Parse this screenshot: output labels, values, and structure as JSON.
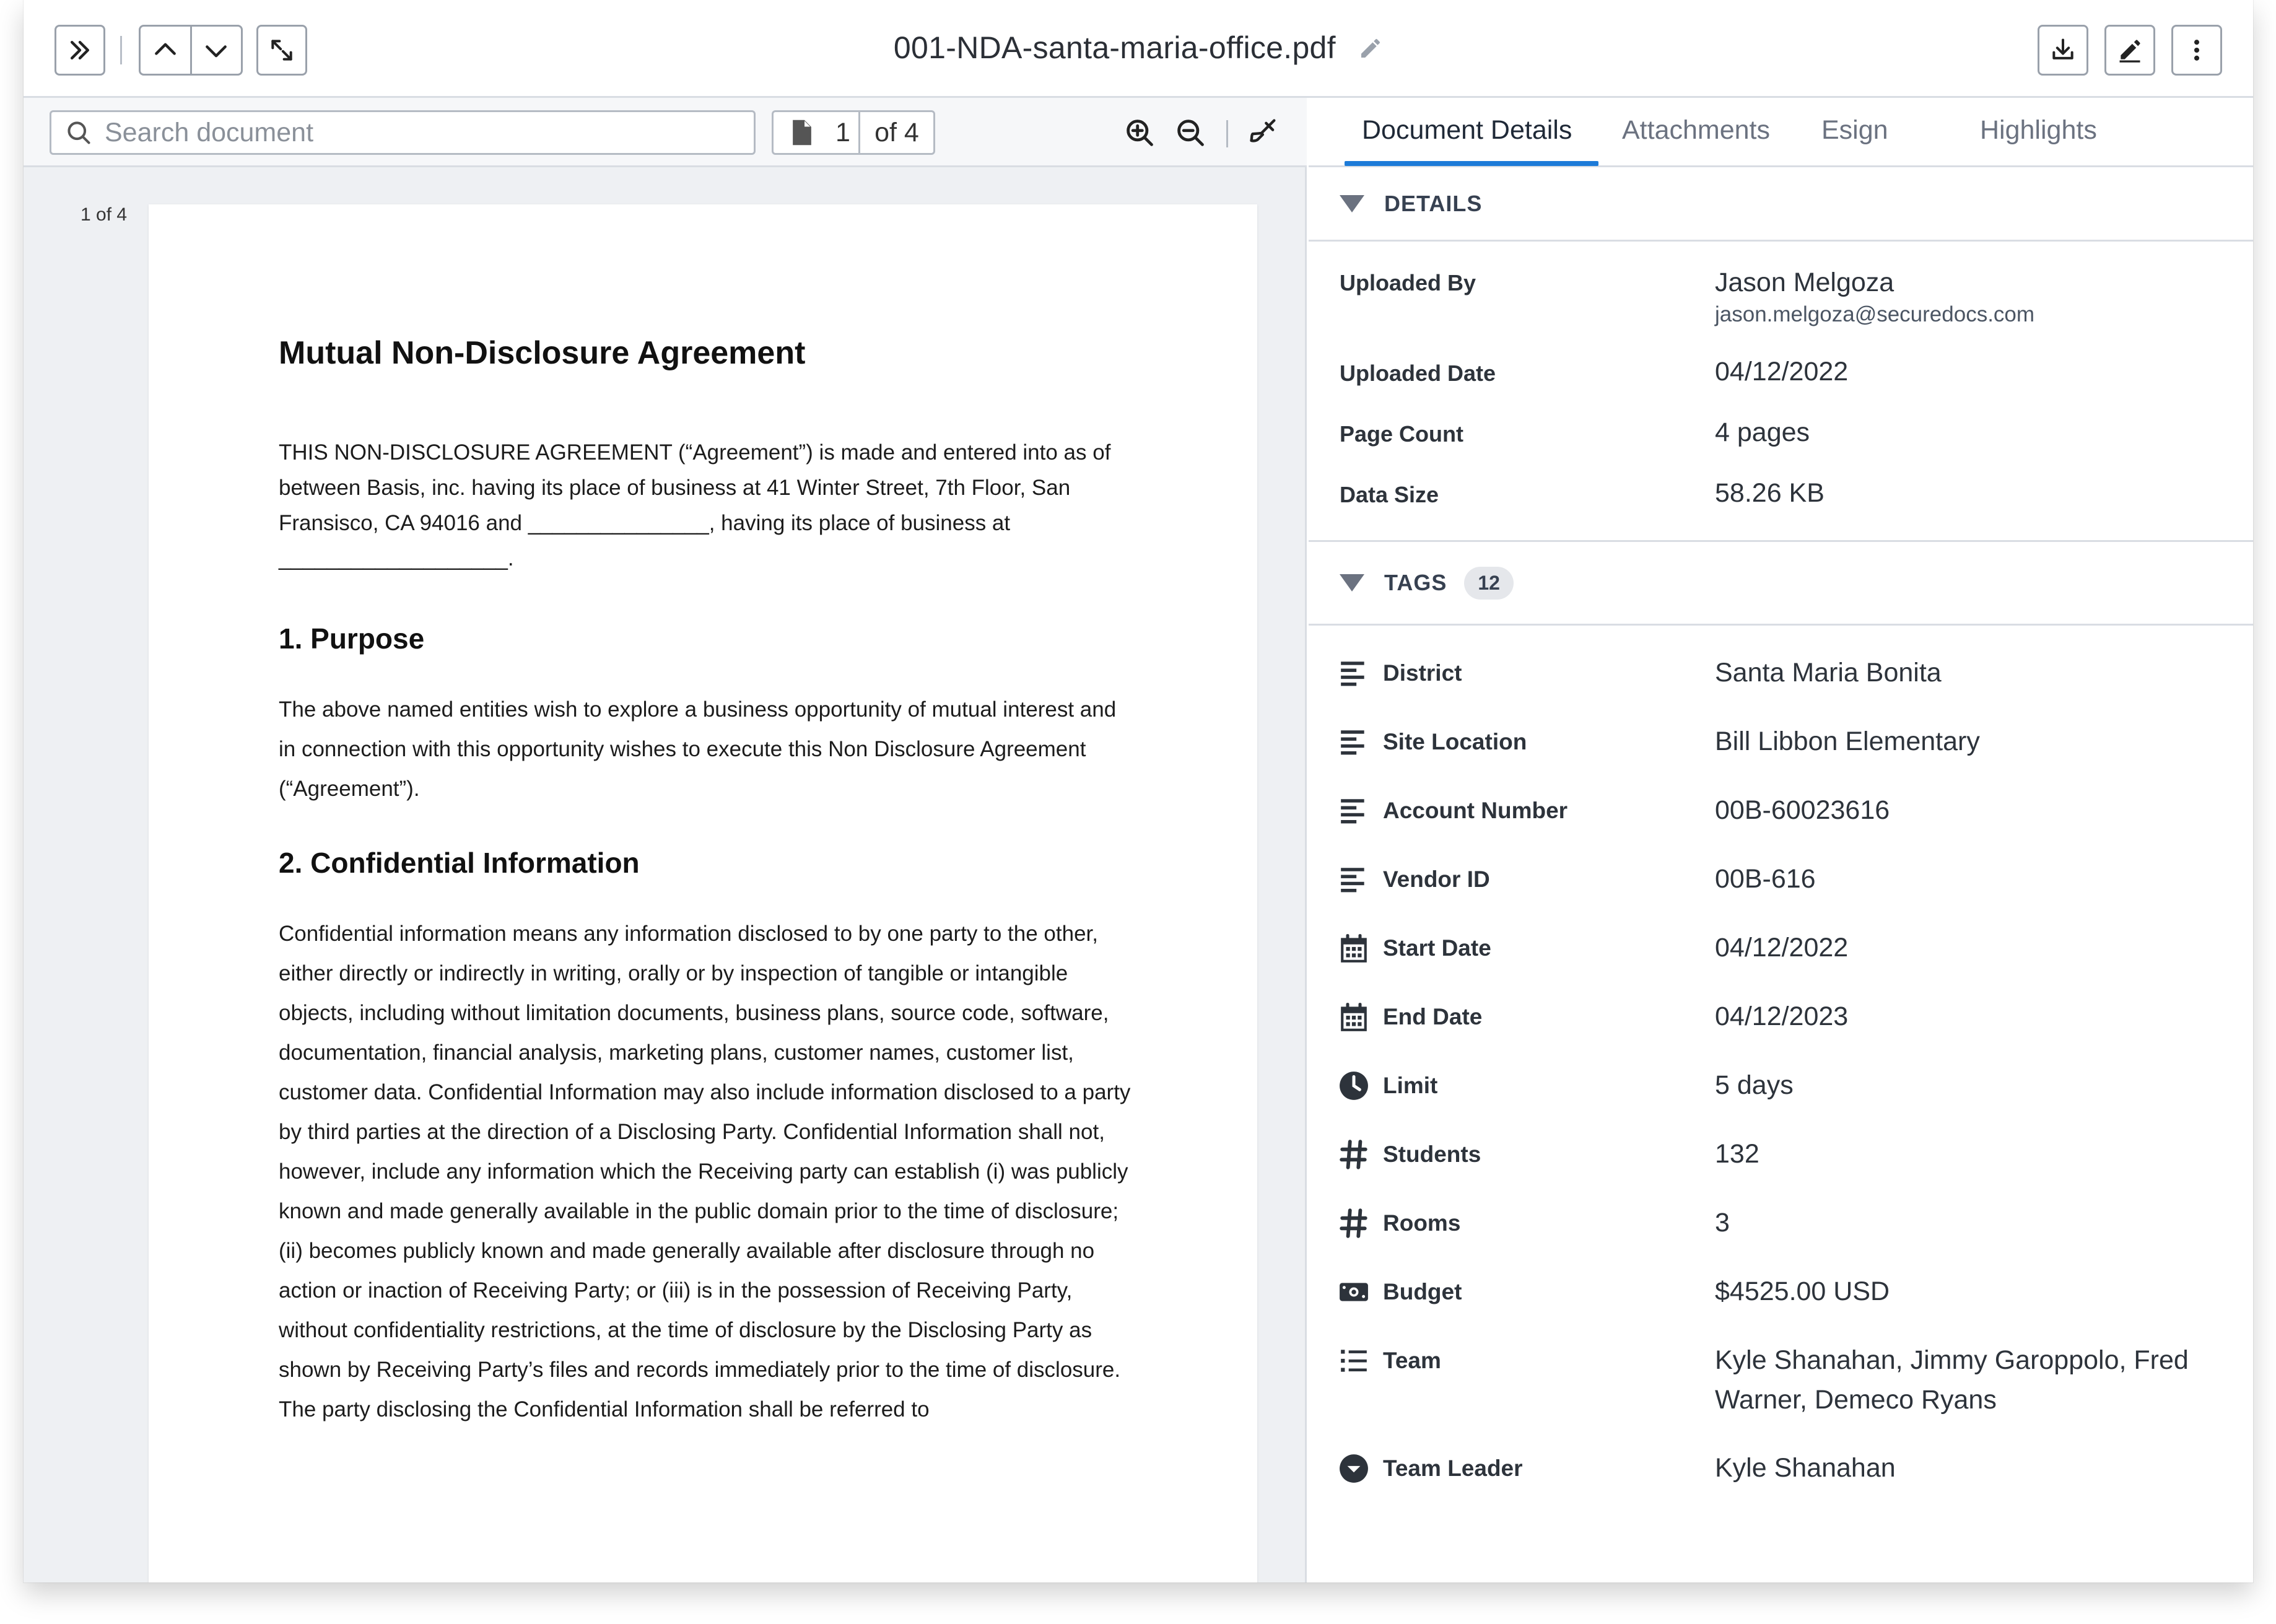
{
  "header": {
    "title": "001-NDA-santa-maria-office.pdf"
  },
  "viewer": {
    "search_placeholder": "Search document",
    "current_page": "1",
    "page_total": "of 4",
    "page_indicator": "1 of 4"
  },
  "document": {
    "title": "Mutual Non-Disclosure Agreement",
    "intro": "THIS NON-DISCLOSURE AGREEMENT (“Agreement”) is made and entered into as of between Basis, inc. having its place of business at 41 Winter Street, 7th Floor, San Fransisco, CA 94016 and _______________, having its place of business at ___________________.",
    "section1_heading": "1. Purpose",
    "section1_body": "The above named entities wish to explore a business opportunity of mutual interest and in connection with this opportunity wishes to execute this Non Disclosure Agreement (“Agreement”).",
    "section2_heading": "2. Confidential Information",
    "section2_body": "Confidential information means any information disclosed to by one party to the other, either directly or indirectly in writing, orally or by inspection of tangible or intangible objects, including without limitation documents, business plans, source code, software, documentation, financial analysis, marketing plans, customer names, customer list, customer data. Confidential Information may also include information disclosed to a party by third parties at the direction of a Disclosing Party. Confidential Information shall not, however, include any information which the Receiving party can establish (i) was publicly known and made generally available in the public domain prior to the time of disclosure; (ii) becomes publicly known and made generally available after disclosure through no action or inaction of Receiving Party; or (iii) is in the possession of Receiving Party, without confidentiality restrictions, at the time of disclosure by the Disclosing Party as shown by Receiving Party’s files and records immediately prior to the time of disclosure. The party disclosing the Confidential Information shall be referred to"
  },
  "tabs": [
    "Document Details",
    "Attachments",
    "Esign",
    "Highlights"
  ],
  "details": {
    "heading": "DETAILS",
    "uploaded_by_label": "Uploaded By",
    "uploaded_by_name": "Jason Melgoza",
    "uploaded_by_email": "jason.melgoza@securedocs.com",
    "uploaded_date_label": "Uploaded Date",
    "uploaded_date": "04/12/2022",
    "page_count_label": "Page Count",
    "page_count": "4 pages",
    "data_size_label": "Data Size",
    "data_size": "58.26 KB"
  },
  "tags": {
    "heading": "TAGS",
    "count": "12",
    "items": [
      {
        "label": "District",
        "value": "Santa Maria Bonita",
        "icon": "text-lines-icon"
      },
      {
        "label": "Site Location",
        "value": "Bill Libbon Elementary",
        "icon": "text-lines-icon"
      },
      {
        "label": "Account Number",
        "value": "00B-60023616",
        "icon": "text-lines-icon"
      },
      {
        "label": "Vendor ID",
        "value": "00B-616",
        "icon": "text-lines-icon"
      },
      {
        "label": "Start Date",
        "value": "04/12/2022",
        "icon": "calendar-icon"
      },
      {
        "label": "End Date",
        "value": "04/12/2023",
        "icon": "calendar-icon"
      },
      {
        "label": "Limit",
        "value": "5 days",
        "icon": "clock-icon"
      },
      {
        "label": "Students",
        "value": "132",
        "icon": "hash-icon"
      },
      {
        "label": "Rooms",
        "value": "3",
        "icon": "hash-icon"
      },
      {
        "label": "Budget",
        "value": "$4525.00 USD",
        "icon": "money-icon"
      },
      {
        "label": "Team",
        "value": "Kyle Shanahan, Jimmy Garoppolo, Fred Warner, Demeco Ryans",
        "icon": "list-icon"
      },
      {
        "label": "Team Leader",
        "value": "Kyle Shanahan",
        "icon": "chevron-circle-icon"
      }
    ]
  },
  "colors": {
    "accent": "#1d7bd8",
    "border": "#d9dde3"
  }
}
